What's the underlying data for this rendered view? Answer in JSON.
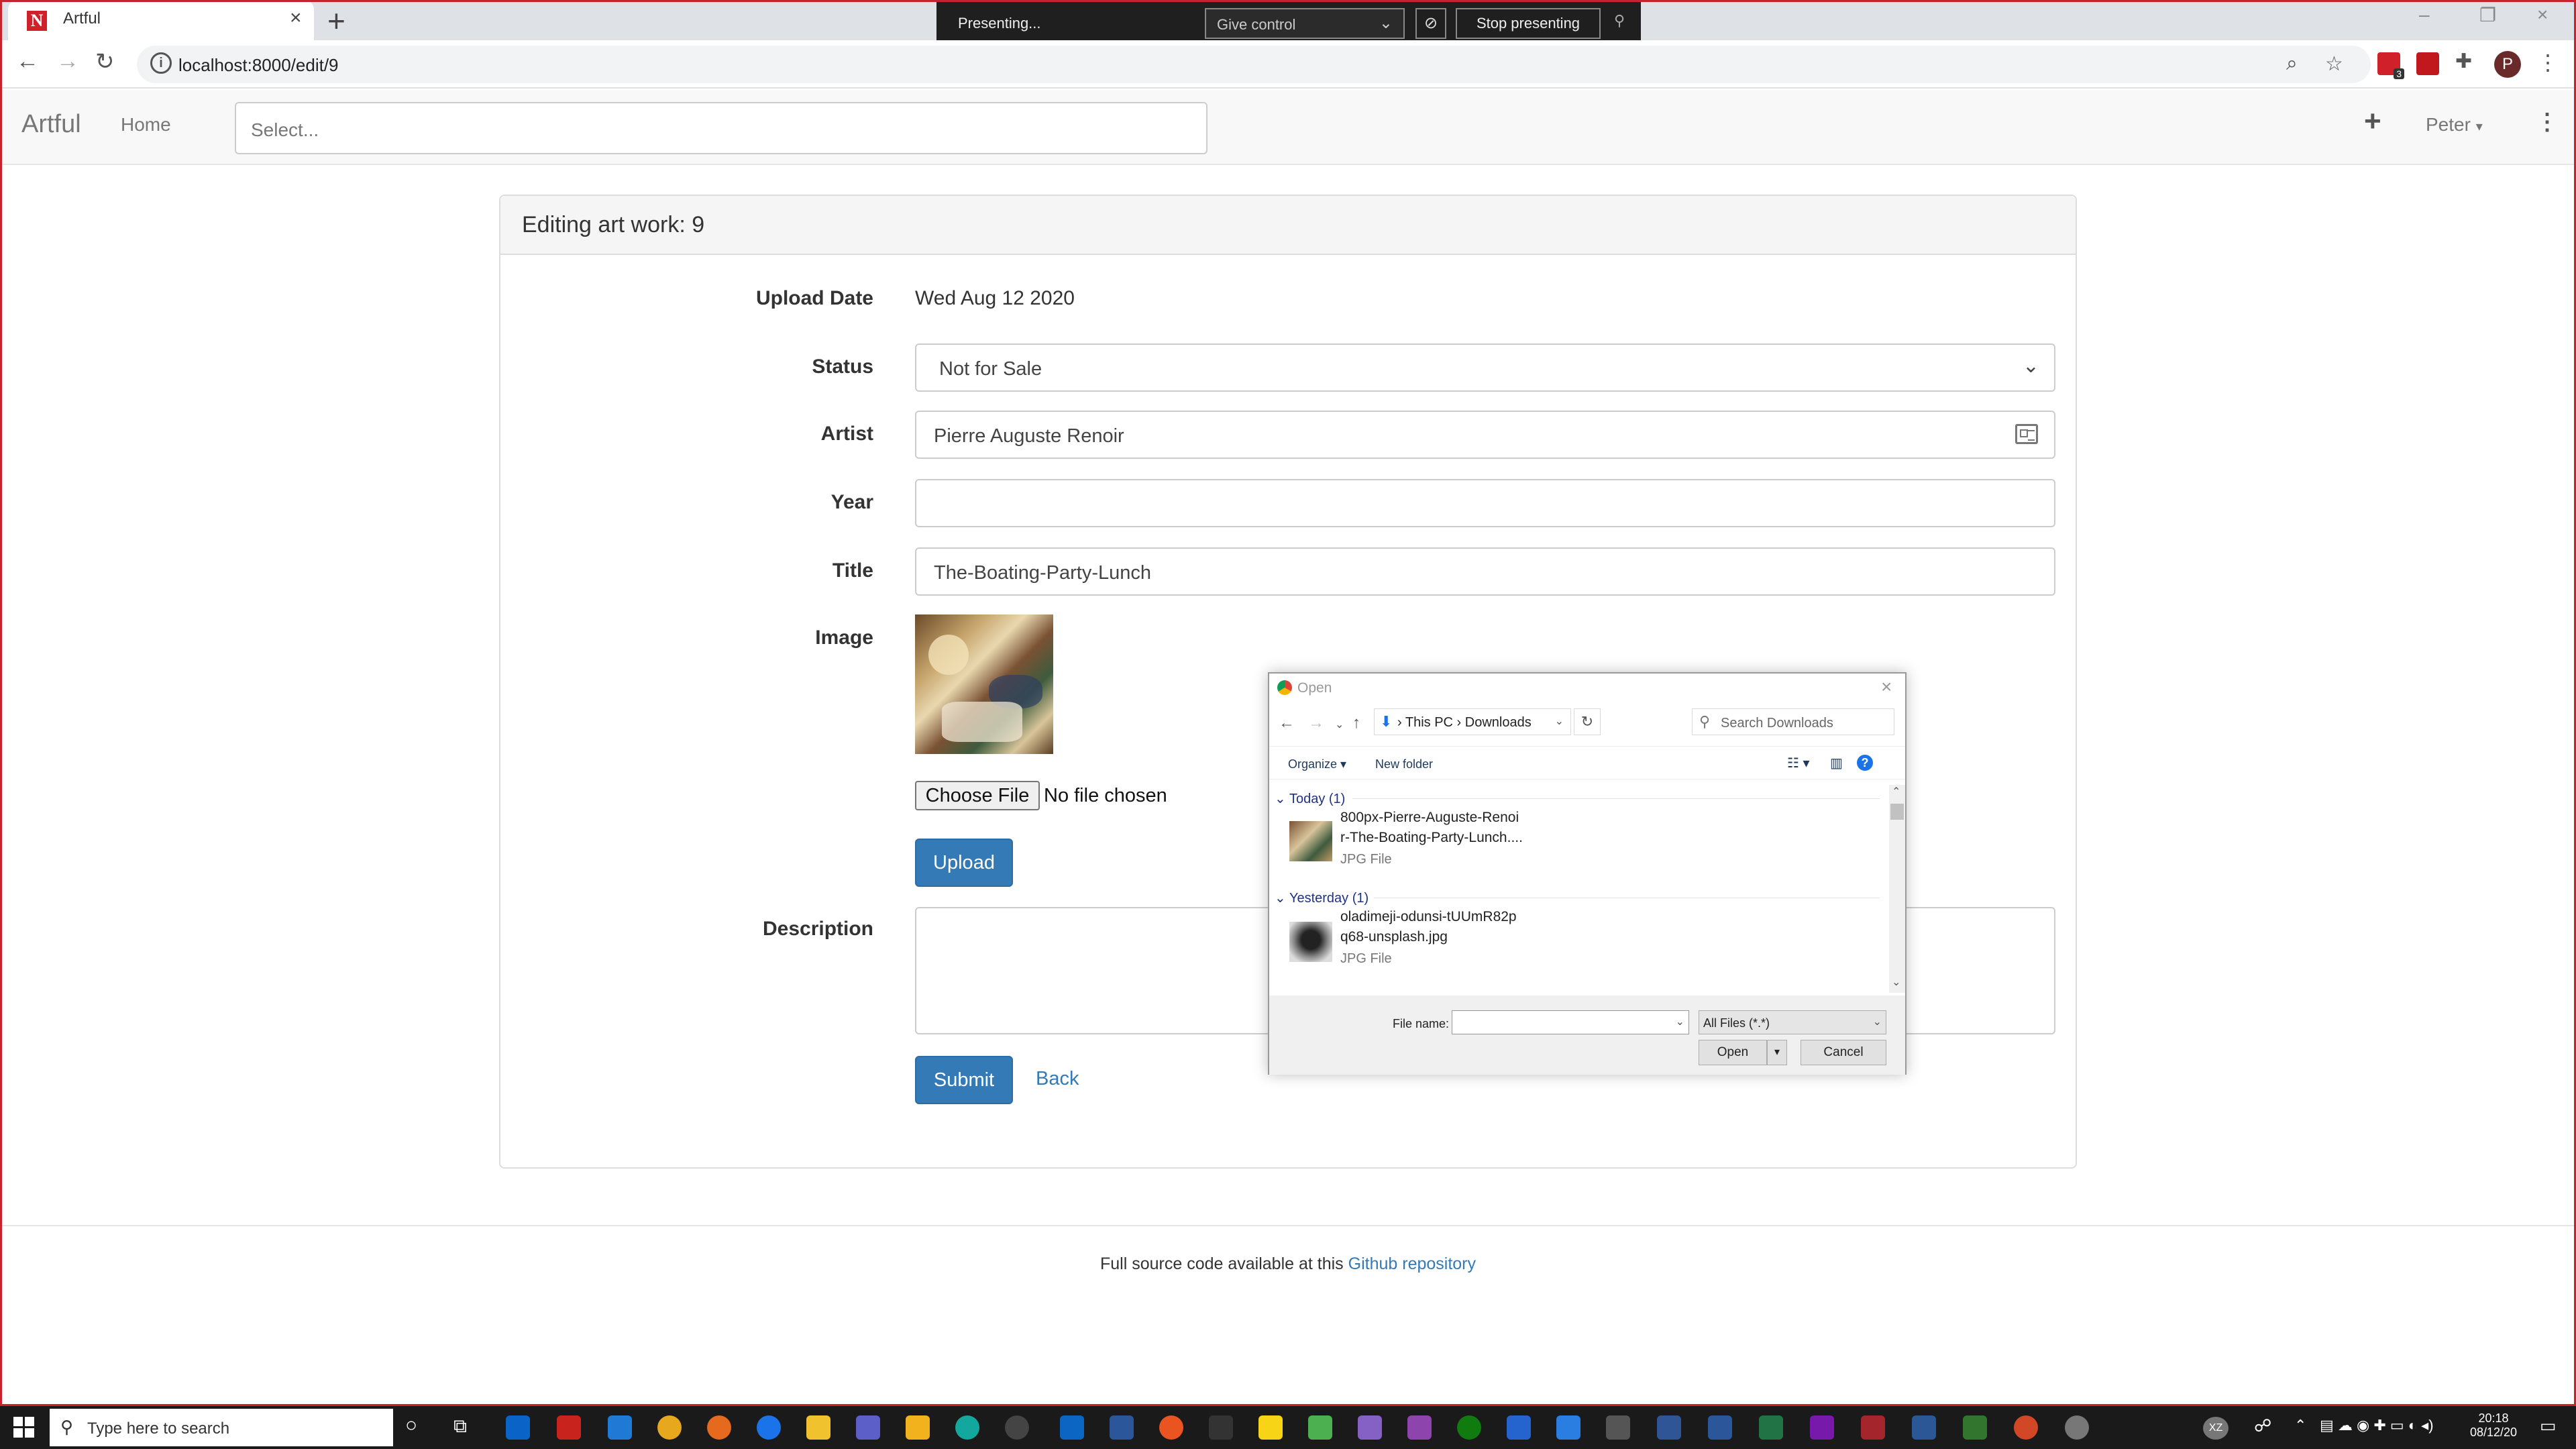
{
  "browser": {
    "tab_title": "Artful",
    "tab_favicon": "N",
    "new_tab": "+",
    "url": "localhost:8000/edit/9",
    "profile_initial": "P",
    "extension_badge": "3"
  },
  "presenting_bar": {
    "status": "Presenting...",
    "give_control": "Give control",
    "stop": "Stop presenting"
  },
  "app_nav": {
    "brand": "Artful",
    "home": "Home",
    "select_placeholder": "Select...",
    "user": "Peter"
  },
  "form": {
    "title": "Editing art work: 9",
    "upload_date_label": "Upload Date",
    "upload_date_value": "Wed Aug 12 2020",
    "status_label": "Status",
    "status_value": "Not for Sale",
    "artist_label": "Artist",
    "artist_value": "Pierre Auguste Renoir",
    "year_label": "Year",
    "year_value": "",
    "title_label": "Title",
    "title_value": "The-Boating-Party-Lunch",
    "image_label": "Image",
    "choose_file": "Choose File",
    "no_file": "No file chosen",
    "upload_button": "Upload",
    "description_label": "Description",
    "description_value": "",
    "submit_button": "Submit",
    "back_link": "Back"
  },
  "footer": {
    "text": "Full source code available at this ",
    "link": "Github repository"
  },
  "open_dialog": {
    "title": "Open",
    "path_this_pc": "This PC",
    "path_downloads": "Downloads",
    "search_placeholder": "Search Downloads",
    "organize": "Organize",
    "new_folder": "New folder",
    "groups": [
      {
        "header": "Today (1)",
        "file_line1": "800px-Pierre-Auguste-Renoi",
        "file_line2": "r-The-Boating-Party-Lunch....",
        "file_type": "JPG File"
      },
      {
        "header": "Yesterday (1)",
        "file_line1": "oladimeji-odunsi-tUUmR82p",
        "file_line2": "q68-unsplash.jpg",
        "file_type": "JPG File"
      }
    ],
    "file_name_label": "File name:",
    "file_name_value": "",
    "file_type_filter": "All Files (*.*)",
    "open_button": "Open",
    "cancel_button": "Cancel"
  },
  "taskbar": {
    "search_placeholder": "Type here to search",
    "time": "20:18",
    "date": "08/12/20",
    "user_initials": "XZ"
  },
  "colors": {
    "accent": "#337ab7",
    "frame": "#c8232c",
    "favicon": "#d0202a"
  }
}
